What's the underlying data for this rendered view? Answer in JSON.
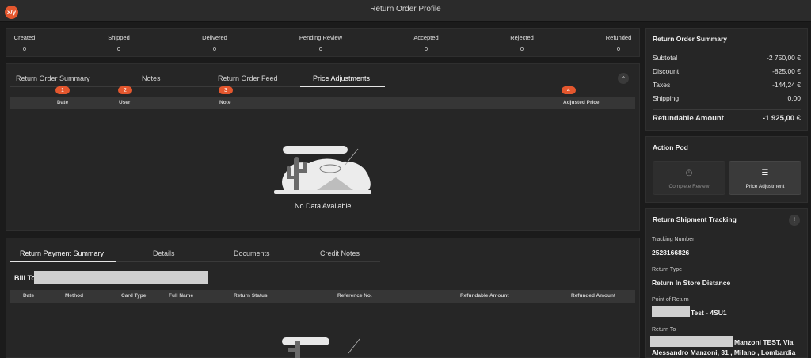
{
  "window": {
    "logo": "x/y",
    "title": "Return Order Profile"
  },
  "status_counts": [
    {
      "label": "Created",
      "value": "0"
    },
    {
      "label": "Shipped",
      "value": "0"
    },
    {
      "label": "Delivered",
      "value": "0"
    },
    {
      "label": "Pending Review",
      "value": "0"
    },
    {
      "label": "Accepted",
      "value": "0"
    },
    {
      "label": "Rejected",
      "value": "0"
    },
    {
      "label": "Refunded",
      "value": "0"
    }
  ],
  "summary": {
    "title": "Return Order Summary",
    "rows": [
      {
        "label": "Subtotal",
        "value": "-2 750,00 €"
      },
      {
        "label": "Discount",
        "value": "-825,00 €"
      },
      {
        "label": "Taxes",
        "value": "-144,24 €"
      },
      {
        "label": "Shipping",
        "value": "0.00"
      }
    ],
    "total_label": "Refundable Amount",
    "total_value": "-1 925,00 €"
  },
  "feed_panel": {
    "tabs": [
      "Return Order Summary",
      "Notes",
      "Return Order Feed",
      "Price Adjustments"
    ],
    "active_tab": "Price Adjustments",
    "badges": [
      "1",
      "2",
      "3",
      "4"
    ],
    "columns": [
      "Date",
      "User",
      "Note",
      "Adjusted Price"
    ],
    "empty_text": "No Data Available"
  },
  "payment_panel": {
    "tabs": [
      "Return Payment Summary",
      "Details",
      "Documents",
      "Credit Notes"
    ],
    "active_tab": "Return Payment Summary",
    "bill_to_label": "Bill To",
    "columns": [
      "Date",
      "Method",
      "Card Type",
      "Full Name",
      "Return Status",
      "Reference No.",
      "Refundable Amount",
      "Refunded Amount"
    ]
  },
  "action_pod": {
    "title": "Action Pod",
    "buttons": [
      {
        "label": "Complete Review",
        "icon": "clock-icon",
        "enabled": false
      },
      {
        "label": "Price Adjustment",
        "icon": "sliders-icon",
        "enabled": true
      }
    ]
  },
  "tracking": {
    "title": "Return Shipment Tracking",
    "tracking_number_label": "Tracking Number",
    "tracking_number": "2528166826",
    "return_type_label": "Return Type",
    "return_type": "Return In Store Distance",
    "point_label": "Point of Return",
    "point_value": "Test - 4SU1",
    "return_to_label": "Return To",
    "return_to_line1": "Manzoni TEST, Via",
    "return_to_line2": "Alessandro Manzoni, 31 , Milano , Lombardia"
  },
  "colors": {
    "accent": "#e4572e",
    "background": "#1b1b1b",
    "panel": "#262626"
  }
}
